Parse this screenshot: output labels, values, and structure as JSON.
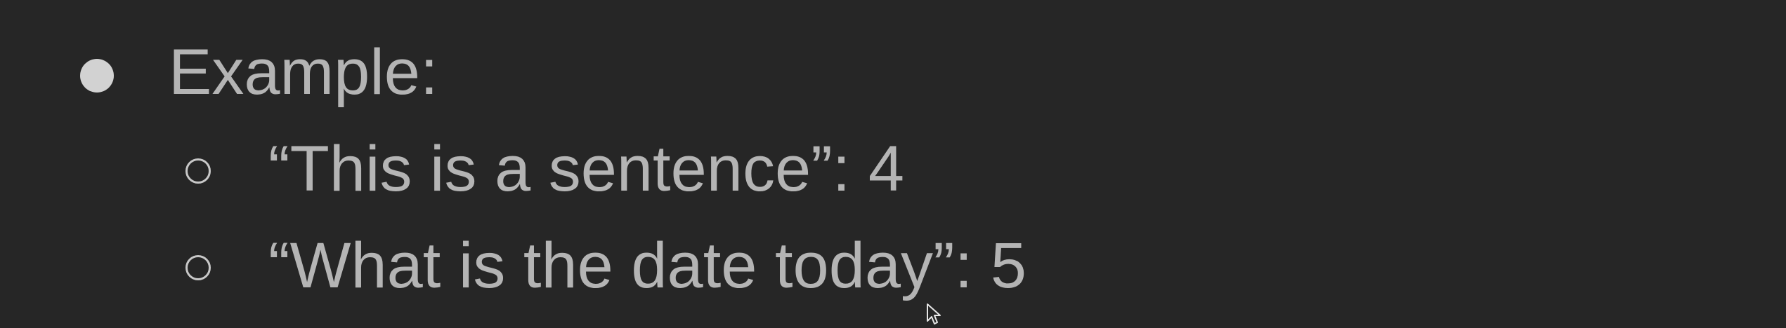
{
  "slide": {
    "heading_item": {
      "text": "Example:"
    },
    "sub_items": [
      {
        "text": "“This is a sentence”: 4"
      },
      {
        "text": "“What is the date today”: 5"
      }
    ]
  },
  "colors": {
    "background": "#262626",
    "text": "#b4b4b4",
    "bullet": "#d2d2d2"
  },
  "icons": {
    "cursor": "mouse-pointer-icon"
  }
}
